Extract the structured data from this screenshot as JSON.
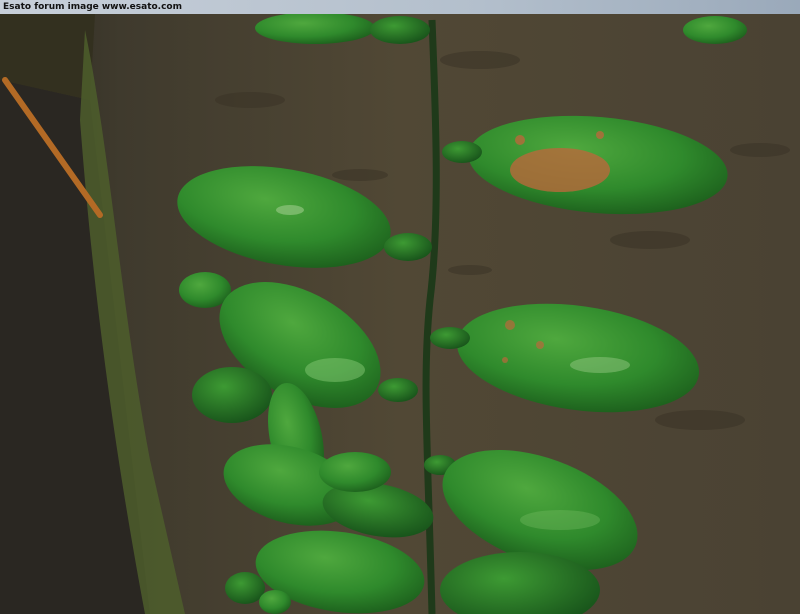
{
  "banner": {
    "text": "Esato forum image www.esato.com"
  },
  "photo": {
    "subject_colors": {
      "leaf": "#2f8a2c",
      "leaf_highlight": "#5fb84a",
      "bark": "#4a4130",
      "moss": "#4f6a2a",
      "stem": "#1f3a1a"
    }
  }
}
